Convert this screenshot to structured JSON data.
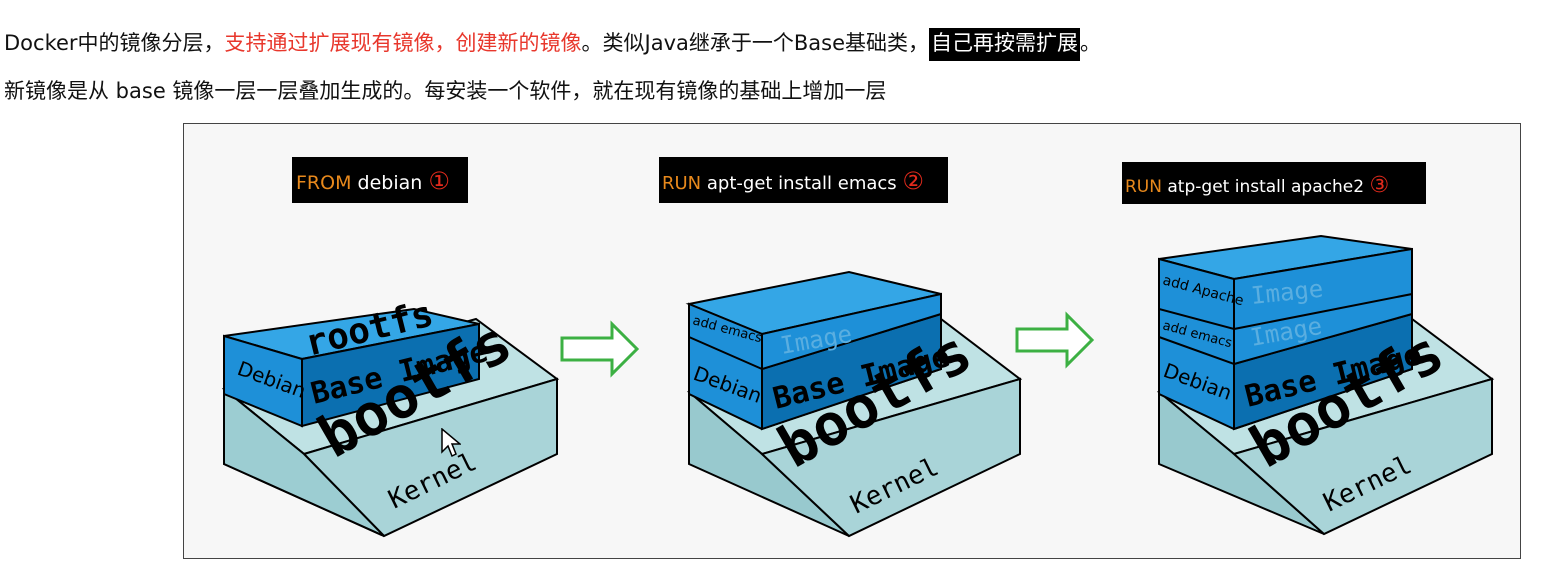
{
  "intro": {
    "line1": {
      "part1": "Docker中的镜像分层，",
      "part2_red": "支持通过扩展现有镜像，创建新的镜像",
      "part3": "。类似Java继承于一个Base基础类，",
      "part4_highlight": "自己再按需扩展",
      "part5": "。"
    },
    "line2": "新镜像是从 base 镜像一层一层叠加生成的。每安装一个软件，就在现有镜像的基础上增加一层"
  },
  "stages": [
    {
      "cmd_keyword": "FROM",
      "cmd_text": " debian ",
      "cmd_number": "①",
      "layers": {
        "rootfs": "rootfs",
        "debian": "Debian",
        "base_image": "Base Image",
        "bootfs": "bootfs",
        "kernel": "Kernel"
      }
    },
    {
      "cmd_keyword": "RUN",
      "cmd_text": " apt-get install emacs ",
      "cmd_number": "②",
      "layers": {
        "add_layer": "add emacs",
        "image": "Image",
        "debian": "Debian",
        "base_image": "Base Image",
        "bootfs": "bootfs",
        "kernel": "Kernel"
      }
    },
    {
      "cmd_keyword": "RUN",
      "cmd_text": " atp-get install apache2 ",
      "cmd_number": "③",
      "layers": {
        "add_apache": "add Apache",
        "image_top": "Image",
        "add_emacs": "add emacs",
        "image_mid": "Image",
        "debian": "Debian",
        "base_image": "Base Image",
        "bootfs": "bootfs",
        "kernel": "Kernel"
      }
    }
  ],
  "colors": {
    "layer_blue": "#1e90d8",
    "layer_blue_dark": "#0b6fb0",
    "layer_blue_top": "#34a6e6",
    "kernel_face": "#a9d4d8",
    "kernel_top": "#bfe2e4",
    "arrow_green": "#3cb043",
    "cmd_orange": "#e8891c",
    "num_red": "#e22a1c",
    "text_red": "#e8372c"
  }
}
